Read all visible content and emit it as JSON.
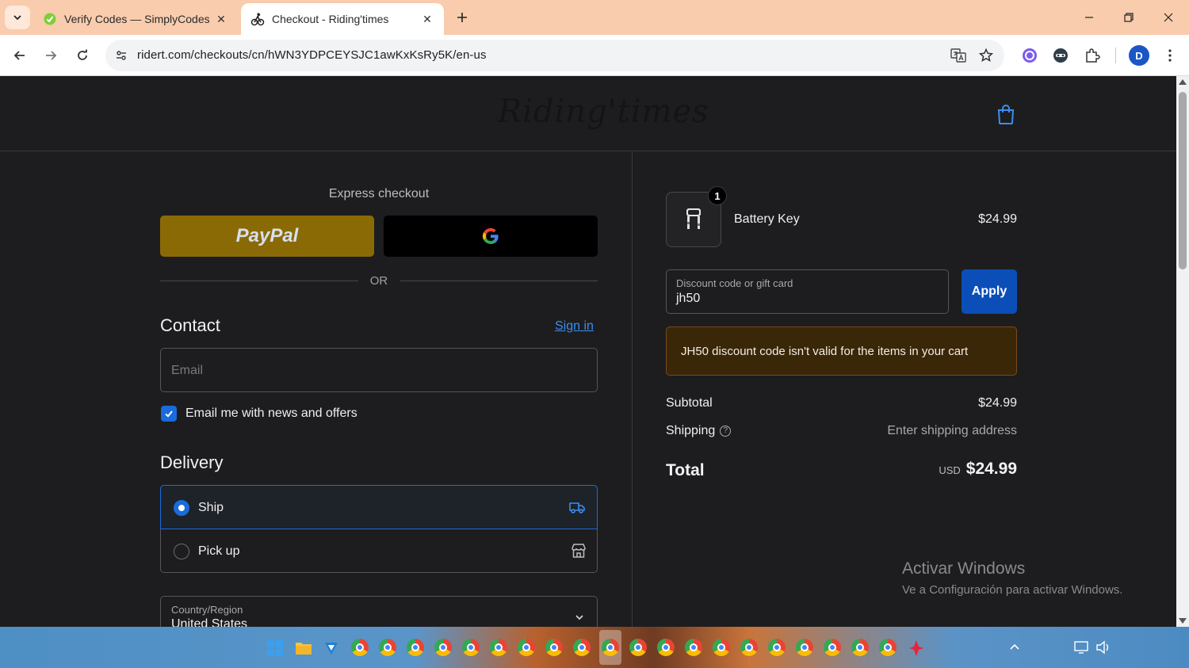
{
  "browser": {
    "tabs": [
      {
        "title": "Verify Codes — SimplyCodes",
        "icon": "simplycodes-favicon"
      },
      {
        "title": "Checkout - Riding'times",
        "icon": "riding-times-favicon"
      }
    ],
    "url": "ridert.com/checkouts/cn/hWN3YDPCEYSJC1awKxKsRy5K/en-us",
    "profile_initial": "D"
  },
  "header": {
    "logo_text": "Riding'times"
  },
  "checkout": {
    "express_title": "Express checkout",
    "paypal_label": "PayPal",
    "or_text": "OR",
    "contact_title": "Contact",
    "sign_in": "Sign in",
    "email_placeholder": "Email",
    "marketing_label": "Email me with news and offers",
    "marketing_checked": true,
    "delivery_title": "Delivery",
    "delivery_options": [
      {
        "label": "Ship",
        "selected": true,
        "icon": "truck-icon"
      },
      {
        "label": "Pick up",
        "selected": false,
        "icon": "store-icon"
      }
    ],
    "country_label": "Country/Region",
    "country_value": "United States"
  },
  "summary": {
    "item": {
      "name": "Battery Key",
      "price": "$24.99",
      "quantity": "1"
    },
    "discount_label": "Discount code or gift card",
    "discount_value": "jh50",
    "apply_label": "Apply",
    "error_message": "JH50 discount code isn't valid for the items in your cart",
    "subtotal_label": "Subtotal",
    "subtotal_value": "$24.99",
    "shipping_label": "Shipping",
    "shipping_value": "Enter shipping address",
    "total_label": "Total",
    "total_currency": "USD",
    "total_value": "$24.99"
  },
  "watermark": {
    "line1": "Activar Windows",
    "line2": "Ve a Configuración para activar Windows."
  },
  "colors": {
    "page_bg": "#1d1d1f",
    "accent": "#1a6bdc",
    "apply_bg": "#0b4eb8",
    "paypal_bg": "#8a6a05",
    "error_bg": "#3a2708"
  }
}
